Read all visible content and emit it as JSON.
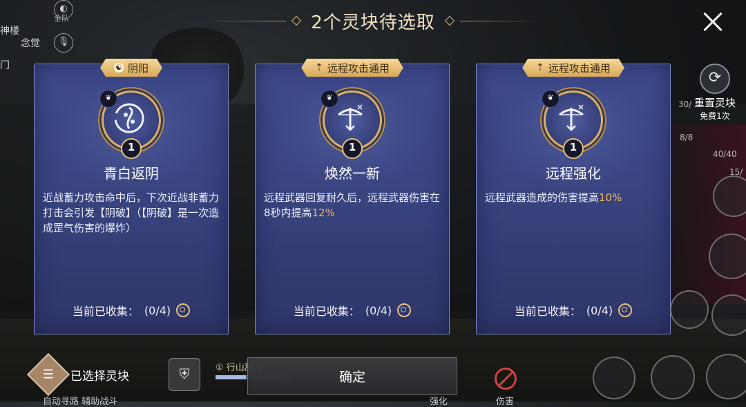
{
  "header": {
    "title": "2个灵块待选取"
  },
  "hud_left": {
    "map_label_1": "神楼",
    "map_label_2": "念觉",
    "map_label_3": "门",
    "team_label": "全队"
  },
  "cards": [
    {
      "tag": "阴阳",
      "tag_icon": "yin-yang-icon",
      "emblem": "yin-yang-swirl-icon",
      "badge": "butterfly-icon",
      "level": "1",
      "name": "青白返阴",
      "desc_parts": [
        "近战蓄力攻击命中后，下次近战非蓄力打击会引发【阴破】（【阴破】是一次造成罡气伤害的爆炸）"
      ],
      "collect_label": "当前已收集：",
      "collect_value": "(0/4)"
    },
    {
      "tag": "远程攻击通用",
      "tag_icon": "arrow-up-icon",
      "emblem": "bow-icon",
      "badge": "butterfly-icon",
      "level": "1",
      "name": "焕然一新",
      "desc_main": "远程武器回复耐久后，远程武器伤害在8秒内提高",
      "desc_highlight": "12%",
      "collect_label": "当前已收集：",
      "collect_value": "(0/4)"
    },
    {
      "tag": "远程攻击通用",
      "tag_icon": "arrow-up-icon",
      "emblem": "bow-icon",
      "badge": "butterfly-icon",
      "level": "1",
      "name": "远程强化",
      "desc_main": "远程武器造成的伤害提高",
      "desc_highlight": "10%",
      "collect_label": "当前已收集：",
      "collect_value": "(0/4)"
    }
  ],
  "reset": {
    "label": "重置灵块",
    "sub": "免费1次"
  },
  "hud_right": {
    "stat1": "30/",
    "stat2": "8/8",
    "stat3": "40/40",
    "stat4": "15/"
  },
  "bottom": {
    "selected_label": "已选择灵块",
    "confirm_label": "确定",
    "quest_num": "①",
    "quest_label": "行山敌人",
    "quest_progress": 0.4,
    "left_sub": "自动寻路 辅助战斗",
    "strengthen": "强化",
    "damage": "伤害"
  },
  "colors": {
    "card_bg": "#3b4684",
    "card_border": "#7d88c6",
    "tag_gold": "#e8c07a",
    "highlight": "#f0b862"
  }
}
